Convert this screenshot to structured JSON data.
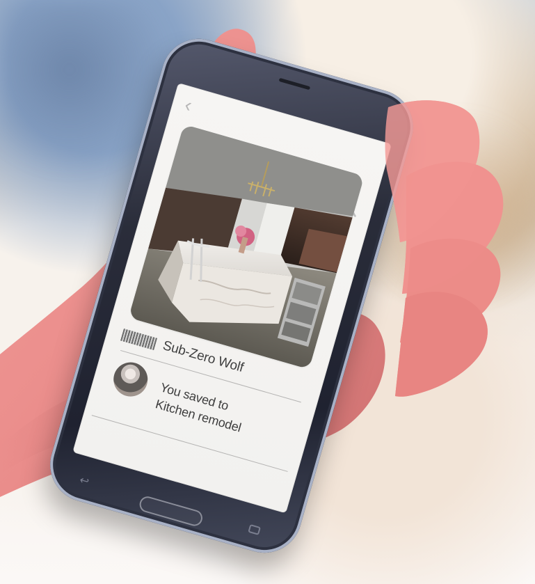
{
  "screen": {
    "brand_name": "Sub-Zero Wolf",
    "saved_line_1": "You saved to",
    "saved_line_2": "Kitchen remodel"
  },
  "icons": {
    "back": "back-chevron-icon",
    "search": "search-icon",
    "home": "home-button-icon",
    "recent": "recent-apps-icon",
    "back_key": "back-key-icon"
  },
  "colors": {
    "text": "#404040",
    "screen_bg": "#f4f3f1",
    "phone_frame": "#2a2d3a",
    "phone_edge": "#a8b1c6"
  }
}
